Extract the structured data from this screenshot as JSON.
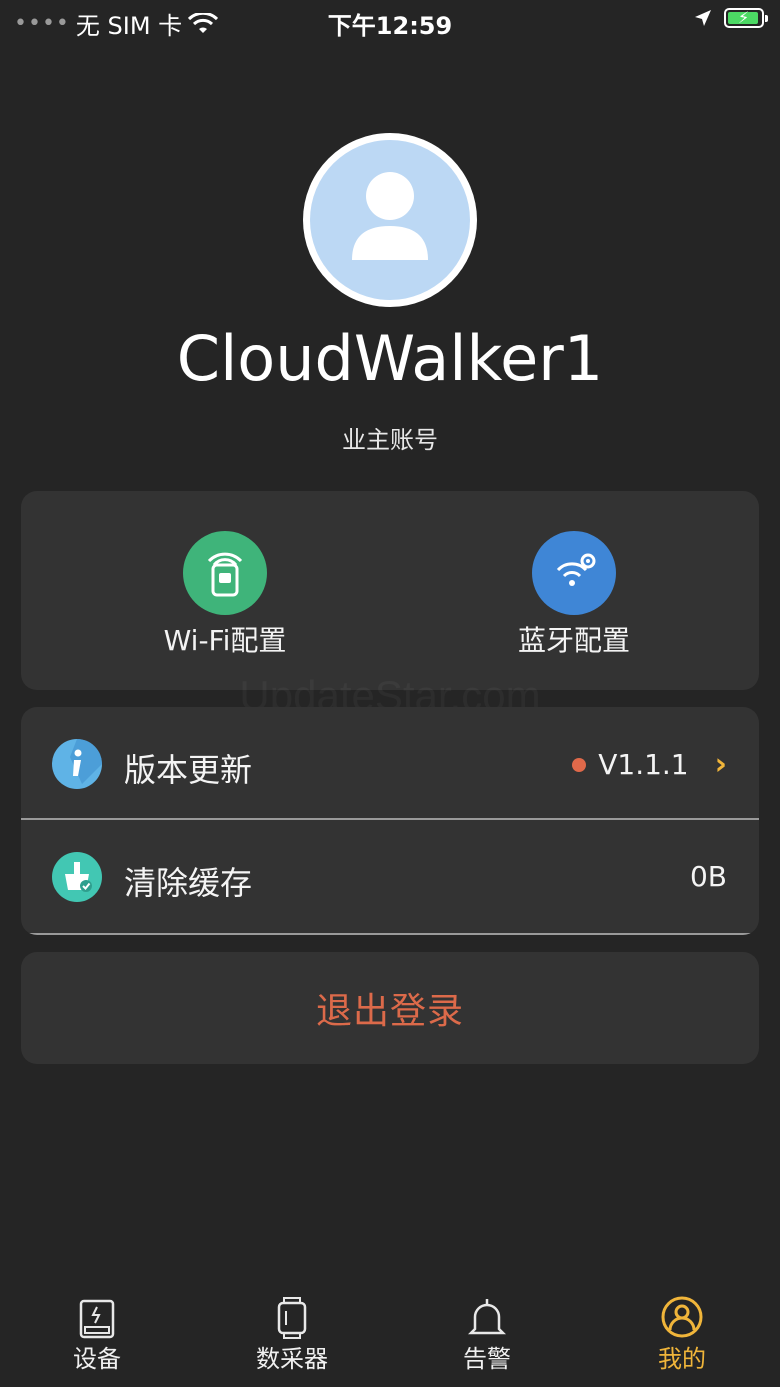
{
  "status_bar": {
    "carrier": "无 SIM 卡",
    "time": "下午12:59"
  },
  "profile": {
    "username": "CloudWalker1",
    "account_type": "业主账号"
  },
  "config": {
    "wifi_label": "Wi-Fi配置",
    "bluetooth_label": "蓝牙配置"
  },
  "menu": {
    "version_label": "版本更新",
    "version_value": "V1.1.1",
    "cache_label": "清除缓存",
    "cache_value": "0B"
  },
  "logout": {
    "label": "退出登录"
  },
  "watermark": "UpdateStar.com",
  "tabs": [
    {
      "label": "设备",
      "icon": "device-icon"
    },
    {
      "label": "数采器",
      "icon": "collector-icon"
    },
    {
      "label": "告警",
      "icon": "bell-icon"
    },
    {
      "label": "我的",
      "icon": "user-icon",
      "active": true
    }
  ],
  "colors": {
    "background": "#252525",
    "card": "#333333",
    "accent": "#f0b53a",
    "logout": "#dc6a4a"
  }
}
